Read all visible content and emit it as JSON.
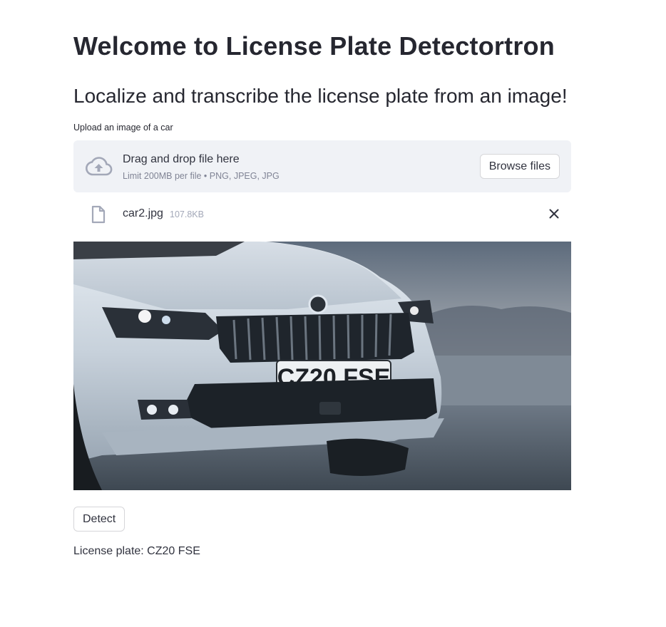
{
  "page": {
    "title": "Welcome to License Plate Detectortron",
    "subtitle": "Localize and transcribe the license plate from an image!"
  },
  "uploader": {
    "label": "Upload an image of a car",
    "drop_text": "Drag and drop file here",
    "limit_text": "Limit 200MB per file • PNG, JPEG, JPG",
    "browse_label": "Browse files",
    "icon": "cloud-upload-icon"
  },
  "uploaded_file": {
    "name": "car2.jpg",
    "size": "107.8KB",
    "icon": "file-icon",
    "remove_icon": "close-icon"
  },
  "image": {
    "plate_text": "CZ20 FSE"
  },
  "actions": {
    "detect_label": "Detect"
  },
  "result": {
    "text": "License plate: CZ20 FSE"
  },
  "colors": {
    "text": "#262730",
    "dropzone_bg": "#f0f2f6",
    "muted": "#808495",
    "border": "#d6d6d9"
  }
}
